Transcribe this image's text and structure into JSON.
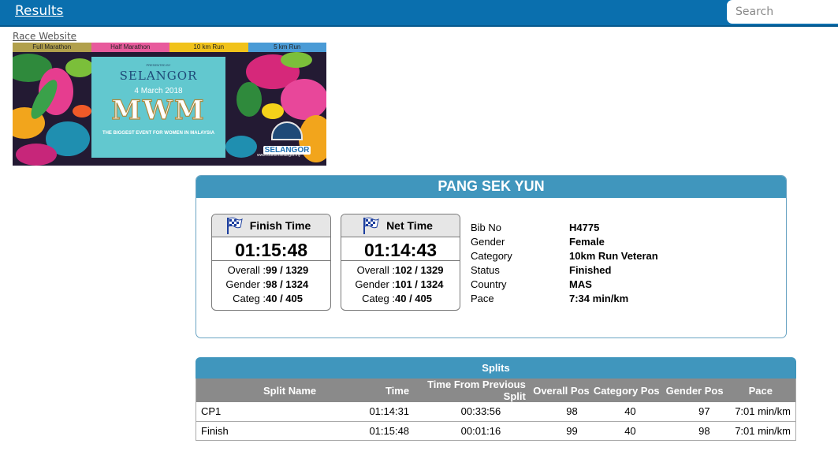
{
  "topbar": {
    "results_label": "Results",
    "search_placeholder": "Search"
  },
  "race_website_label": "Race Website",
  "banner": {
    "tabs": [
      {
        "label": "Full Marathon",
        "color": "#b1a04c"
      },
      {
        "label": "Half Marathon",
        "color": "#e85a9c"
      },
      {
        "label": "10 km Run",
        "color": "#f1c21a"
      },
      {
        "label": "5 km Run",
        "color": "#4a9bd6"
      }
    ],
    "presented": "PRESENTED BY",
    "brand": "SELANGOR",
    "date": "4 March 2018",
    "title": "MWM",
    "tagline": "THE BIGGEST EVENT FOR WOMEN IN MALAYSIA",
    "badge": "SELANGOR",
    "site": "www.tourismselangor.my"
  },
  "athlete": {
    "name": "PANG SEK YUN",
    "finish": {
      "label": "Finish Time",
      "time": "01:15:48",
      "overall_label": "Overall : ",
      "overall": "99 / 1329",
      "gender_label": "Gender : ",
      "gender": "98 / 1324",
      "categ_label": "Categ : ",
      "categ": "40 / 405"
    },
    "net": {
      "label": "Net Time",
      "time": "01:14:43",
      "overall_label": "Overall : ",
      "overall": "102 / 1329",
      "gender_label": "Gender : ",
      "gender": "101 / 1324",
      "categ_label": "Categ : ",
      "categ": "40 / 405"
    },
    "info": [
      {
        "key": "Bib No",
        "value": "H4775"
      },
      {
        "key": "Gender",
        "value": "Female"
      },
      {
        "key": "Category",
        "value": "10km Run Veteran"
      },
      {
        "key": "Status",
        "value": "Finished"
      },
      {
        "key": "Country",
        "value": "MAS"
      },
      {
        "key": "Pace",
        "value": "7:34 min/km"
      }
    ]
  },
  "splits": {
    "title": "Splits",
    "columns": [
      "Split Name",
      "Time",
      "Time From Previous Split",
      "Overall Pos",
      "Category Pos",
      "Gender Pos",
      "Pace"
    ],
    "rows": [
      [
        "CP1",
        "01:14:31",
        "00:33:56",
        "98",
        "40",
        "97",
        "7:01 min/km"
      ],
      [
        "Finish",
        "01:15:48",
        "00:01:16",
        "99",
        "40",
        "98",
        "7:01 min/km"
      ]
    ]
  }
}
